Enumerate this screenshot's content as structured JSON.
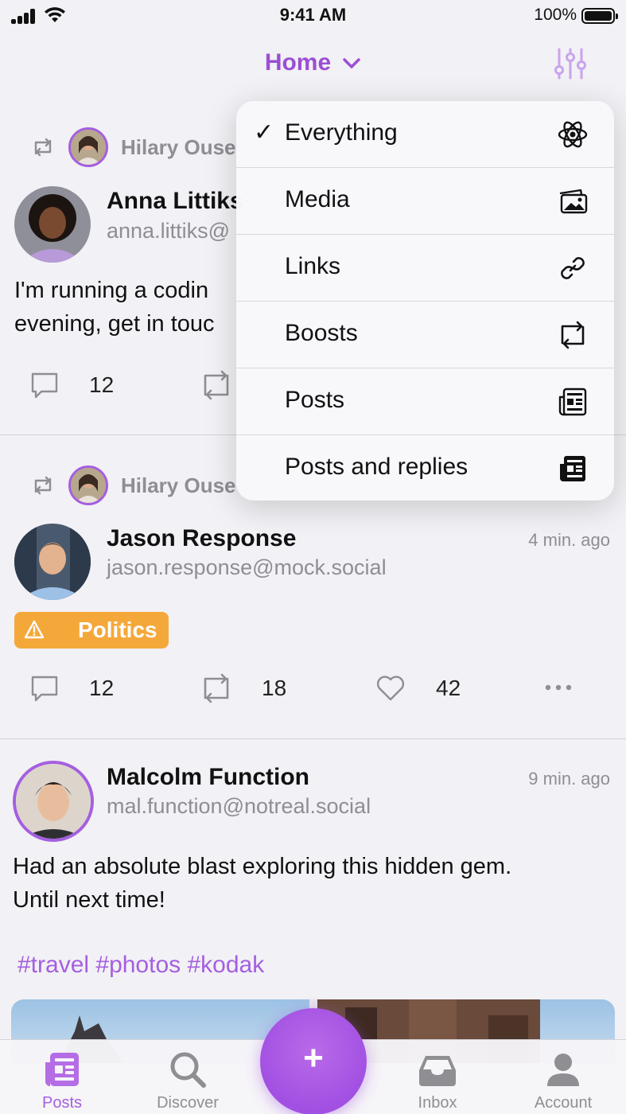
{
  "status_bar": {
    "time": "9:41 AM",
    "battery": "100%"
  },
  "nav": {
    "title": "Home"
  },
  "feed": {
    "post1": {
      "boosted_by": "Hilary Ouse",
      "author_name": "Anna Littiks",
      "author_handle": "anna.littiks@",
      "text_line1": "I'm running a codin",
      "text_line2": "evening, get in touc",
      "replies": "12"
    },
    "post2": {
      "boosted_by": "Hilary Ouse",
      "author_name": "Jason Response",
      "author_handle": "jason.response@mock.social",
      "time": "4 min. ago",
      "content_warning": "Politics",
      "replies": "12",
      "boosts": "18",
      "likes": "42"
    },
    "post3": {
      "author_name": "Malcolm Function",
      "author_handle": "mal.function@notreal.social",
      "time": "9 min. ago",
      "text_line1": "Had an absolute blast exploring this hidden gem.",
      "text_line2": "Until next time!",
      "hashtags": "#travel #photos #kodak"
    }
  },
  "menu": {
    "items": [
      {
        "label": "Everything",
        "checked": true,
        "icon": "atom-icon"
      },
      {
        "label": "Media",
        "checked": false,
        "icon": "photos-icon"
      },
      {
        "label": "Links",
        "checked": false,
        "icon": "link-icon"
      },
      {
        "label": "Boosts",
        "checked": false,
        "icon": "boost-icon"
      },
      {
        "label": "Posts",
        "checked": false,
        "icon": "newspaper-icon"
      },
      {
        "label": "Posts and replies",
        "checked": false,
        "icon": "newspaper-filled-icon"
      }
    ],
    "check_mark": "✓"
  },
  "tab_bar": {
    "tabs": [
      {
        "label": "Posts"
      },
      {
        "label": "Discover"
      },
      {
        "label": "Inbox"
      },
      {
        "label": "Account"
      }
    ],
    "compose": "+"
  },
  "colors": {
    "accent": "#a45fe0",
    "warning": "#f5a83a",
    "secondary_text": "#8e8e93"
  }
}
